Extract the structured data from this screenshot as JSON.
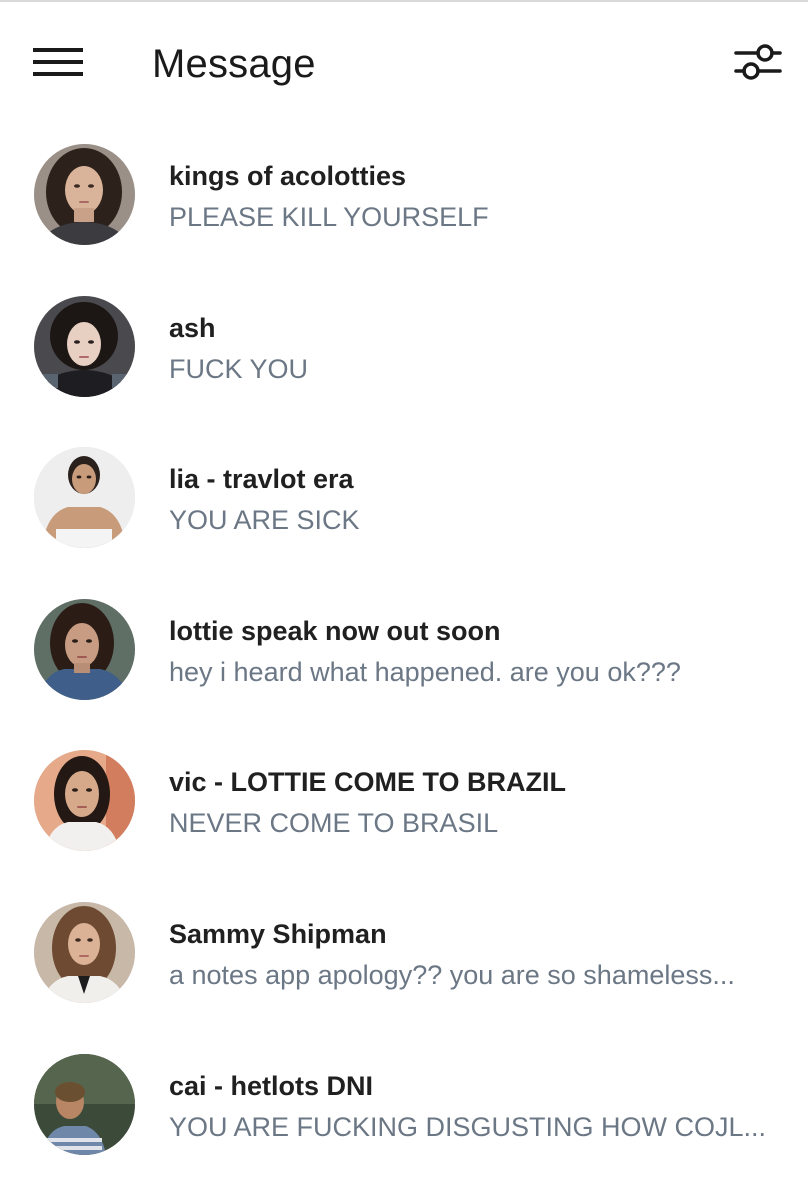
{
  "header": {
    "title": "Message",
    "menu_icon": "hamburger-menu-icon",
    "filter_icon": "sliders-filter-icon"
  },
  "colors": {
    "name_text": "#202020",
    "preview_text": "#6b7785",
    "background": "#ffffff"
  },
  "conversations": [
    {
      "name": "kings of acolotties",
      "preview": "PLEASE KILL YOURSELF"
    },
    {
      "name": "ash",
      "preview": "FUCK YOU"
    },
    {
      "name": "lia - travlot era",
      "preview": "YOU ARE SICK"
    },
    {
      "name": "lottie speak now out soon",
      "preview": "hey i heard what happened. are you ok???"
    },
    {
      "name": "vic - LOTTIE COME TO BRAZIL",
      "preview": "NEVER COME TO BRASIL"
    },
    {
      "name": "Sammy Shipman",
      "preview": "a notes app apology?? you are so shameless..."
    },
    {
      "name": "cai - hetlots DNI",
      "preview": "YOU ARE FUCKING DISGUSTING HOW COJL..."
    }
  ]
}
